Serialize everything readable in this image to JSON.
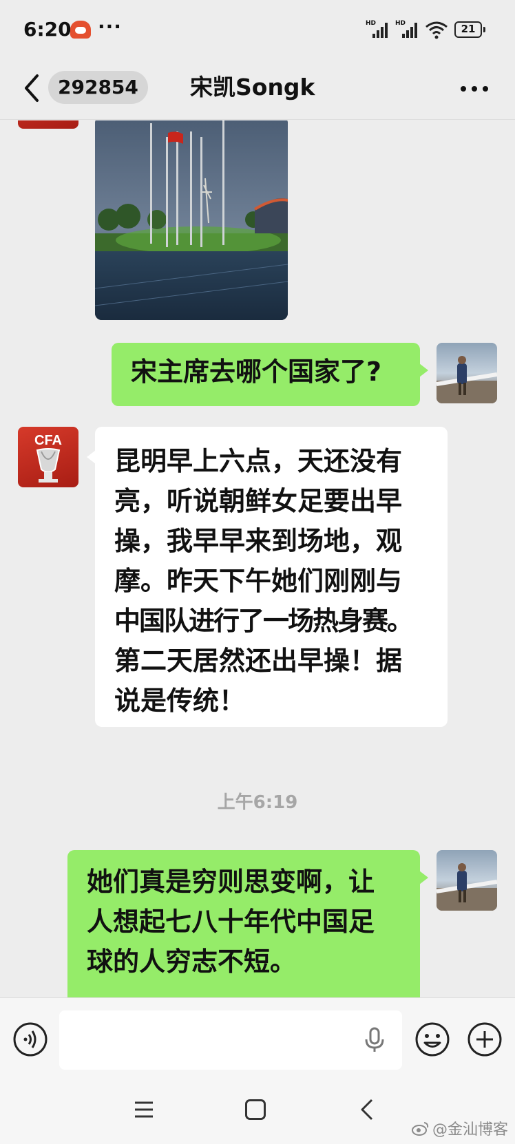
{
  "status_bar": {
    "time": "6:20",
    "dots": "···",
    "network_badge_1": "HD",
    "network_badge_2": "HD",
    "battery": "21"
  },
  "nav": {
    "unread_count": "292854",
    "title": "宋凯Songk"
  },
  "messages": [
    {
      "side": "left",
      "type": "image",
      "subject": "flagpoles-stadium-dawn"
    },
    {
      "side": "right",
      "type": "text",
      "text": "宋主席去哪个国家了?"
    },
    {
      "side": "left",
      "type": "text",
      "lines": [
        "昆明早上六点，天还没有",
        "亮，听说朝鲜女足要出早",
        "操，我早早来到场地，观",
        "摩。昨天下午她们刚刚与",
        "中国队进行了一场热身赛。",
        "第二天居然还出早操！据",
        "说是传统！"
      ]
    },
    {
      "side": "center",
      "type": "timestamp",
      "text": "上午6:19"
    },
    {
      "side": "right",
      "type": "text",
      "lines": [
        "她们真是穷则思变啊，让",
        "人想起七八十年代中国足",
        "球的人穷志不短。"
      ]
    }
  ],
  "input": {
    "placeholder": ""
  },
  "watermark": "@金汕博客",
  "colors": {
    "background": "#ededed",
    "bubble_self": "#95ec69",
    "bubble_other": "#ffffff",
    "timestamp": "#a6a6a6"
  }
}
